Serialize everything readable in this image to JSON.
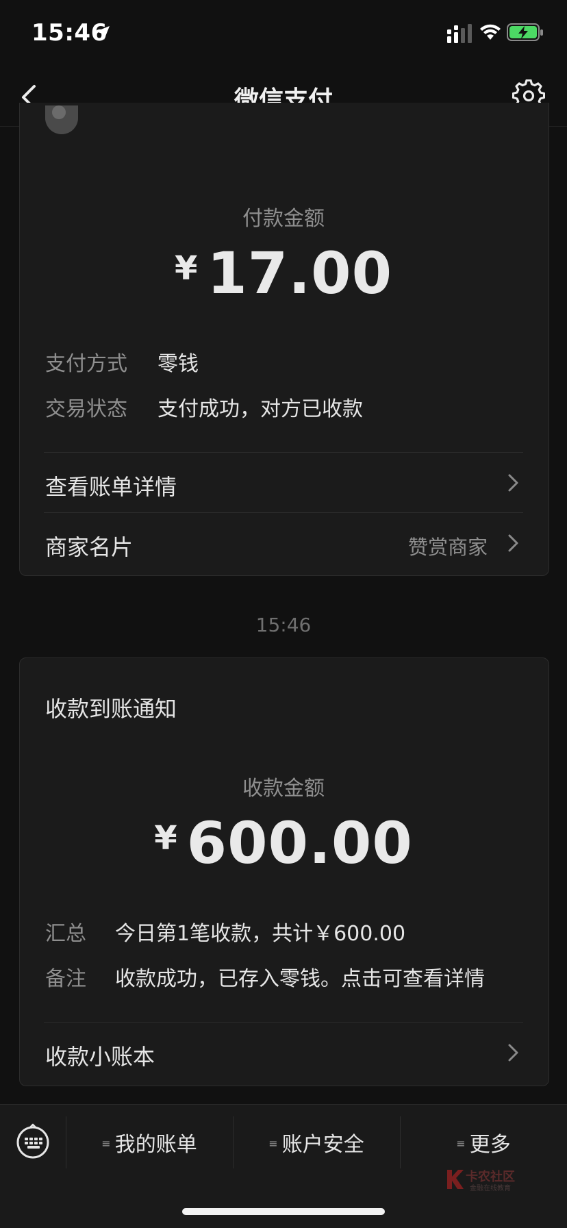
{
  "status_bar": {
    "time": "15:46"
  },
  "nav": {
    "title": "微信支付",
    "back_icon": "chevron-left-icon",
    "settings_icon": "gear-icon"
  },
  "payment_card": {
    "amount_label": "付款金额",
    "currency": "¥",
    "amount": "17.00",
    "rows": [
      {
        "label": "支付方式",
        "value": "零钱"
      },
      {
        "label": "交易状态",
        "value": "支付成功，对方已收款"
      }
    ],
    "links": [
      {
        "label": "查看账单详情",
        "sub": ""
      },
      {
        "label": "商家名片",
        "sub": "赞赏商家"
      }
    ]
  },
  "timestamp": "15:46",
  "receipt_card": {
    "title": "收款到账通知",
    "amount_label": "收款金额",
    "currency": "¥",
    "amount": "600.00",
    "rows": [
      {
        "label": "汇总",
        "value": "今日第1笔收款，共计￥600.00"
      },
      {
        "label": "备注",
        "value": "收款成功，已存入零钱。点击可查看详情"
      }
    ],
    "link": {
      "label": "收款小账本"
    }
  },
  "bottom_bar": {
    "keyboard_icon": "keyboard-icon",
    "tabs": [
      {
        "label": "我的账单"
      },
      {
        "label": "账户安全"
      },
      {
        "label": "更多"
      }
    ],
    "menu_glyph": "≡"
  },
  "watermark": {
    "title": "卡农社区",
    "subtitle": "金融在线教育"
  }
}
